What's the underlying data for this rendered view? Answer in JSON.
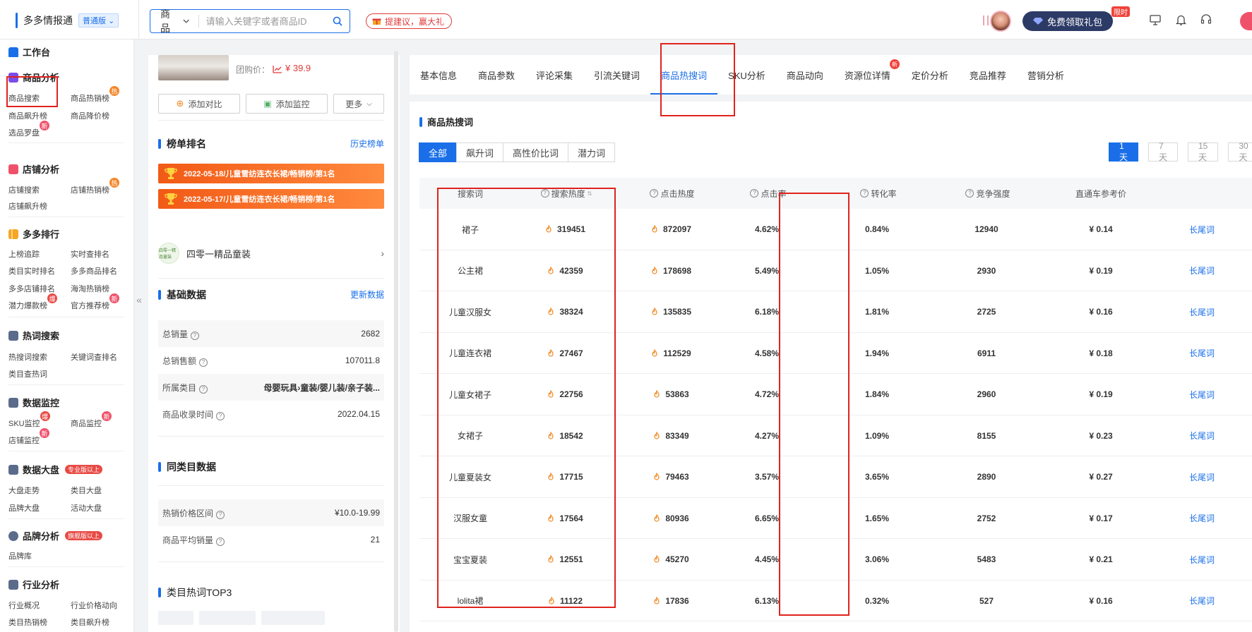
{
  "brand": {
    "name": "多多情报通",
    "plan": "普通版"
  },
  "search": {
    "type": "商品",
    "placeholder": "请输入关键字或者商品ID"
  },
  "suggest_label": "提建议，赢大礼",
  "gift": {
    "label": "免费领取礼包",
    "tag": "限时"
  },
  "sidebar": {
    "sections": [
      {
        "title": "工作台",
        "items": []
      },
      {
        "title": "商品分析",
        "items": [
          {
            "label": "商品搜索"
          },
          {
            "label": "商品热销榜",
            "badge": "热"
          },
          {
            "label": "商品飙升榜"
          },
          {
            "label": "商品降价榜"
          },
          {
            "label": "选品罗盘",
            "badge": "新"
          }
        ]
      },
      {
        "title": "店铺分析",
        "items": [
          {
            "label": "店铺搜索"
          },
          {
            "label": "店铺热销榜",
            "badge": "热"
          },
          {
            "label": "店铺飙升榜"
          }
        ]
      },
      {
        "title": "多多排行",
        "items": [
          {
            "label": "上榜追踪"
          },
          {
            "label": "实时查排名"
          },
          {
            "label": "类目实时排名"
          },
          {
            "label": "多多商品排名"
          },
          {
            "label": "多多店铺排名"
          },
          {
            "label": "海淘热销榜"
          },
          {
            "label": "潜力爆款榜",
            "badge": "爆"
          },
          {
            "label": "官方推荐榜",
            "badge": "新"
          }
        ]
      },
      {
        "title": "热词搜索",
        "items": [
          {
            "label": "热搜词搜索"
          },
          {
            "label": "关键词查排名"
          },
          {
            "label": "类目查热词"
          }
        ]
      },
      {
        "title": "数据监控",
        "items": [
          {
            "label": "SKU监控",
            "badge": "爆"
          },
          {
            "label": "商品监控",
            "badge": "新"
          },
          {
            "label": "店铺监控",
            "badge": "新"
          }
        ]
      },
      {
        "title": "数据大盘",
        "tier": "专业版以上",
        "items": [
          {
            "label": "大盘走势"
          },
          {
            "label": "类目大盘"
          },
          {
            "label": "品牌大盘"
          },
          {
            "label": "活动大盘"
          }
        ]
      },
      {
        "title": "品牌分析",
        "tier": "旗舰版以上",
        "items": [
          {
            "label": "品牌库"
          }
        ]
      },
      {
        "title": "行业分析",
        "items": [
          {
            "label": "行业概况"
          },
          {
            "label": "行业价格动向"
          },
          {
            "label": "类目热销榜"
          },
          {
            "label": "类目飙升榜"
          }
        ]
      }
    ]
  },
  "product": {
    "price_label": "团购价：",
    "price": "¥ 39.9",
    "buttons": {
      "compare": "添加对比",
      "monitor": "添加监控",
      "more": "更多"
    }
  },
  "ranking": {
    "title": "榜单排名",
    "link": "历史榜单",
    "banners": [
      "2022-05-18/儿童雪纺连衣长裙/畅销榜/第1名",
      "2022-05-17/儿童雪纺连衣长裙/畅销榜/第1名"
    ],
    "shop_logo": "四零一精品童装",
    "shop": "四零一精品童装"
  },
  "basic": {
    "title": "基础数据",
    "link": "更新数据",
    "rows": [
      {
        "label": "总销量",
        "value": "2682"
      },
      {
        "label": "总销售额",
        "value": "107011.8"
      },
      {
        "label": "所属类目",
        "value": "母婴玩具›童装/婴儿装/亲子装..."
      },
      {
        "label": "商品收录时间",
        "value": "2022.04.15"
      }
    ]
  },
  "same_category": {
    "title": "同类目数据",
    "rows": [
      {
        "label": "热销价格区间",
        "value": "¥10.0-19.99"
      },
      {
        "label": "商品平均销量",
        "value": "21"
      }
    ]
  },
  "top3": {
    "title": "类目热词TOP3"
  },
  "tabs": [
    {
      "label": "基本信息"
    },
    {
      "label": "商品参数"
    },
    {
      "label": "评论采集"
    },
    {
      "label": "引流关键词"
    },
    {
      "label": "商品热搜词",
      "active": true
    },
    {
      "label": "SKU分析"
    },
    {
      "label": "商品动向"
    },
    {
      "label": "资源位详情",
      "badge": "新"
    },
    {
      "label": "定价分析"
    },
    {
      "label": "竞品推荐"
    },
    {
      "label": "营销分析"
    }
  ],
  "hot": {
    "title": "商品热搜词",
    "filters": [
      "全部",
      "飙升词",
      "高性价比词",
      "潜力词"
    ],
    "ranges": [
      "1天",
      "7天",
      "15天",
      "30天"
    ],
    "headers": [
      "搜索词",
      "搜索热度",
      "点击热度",
      "点击率",
      "转化率",
      "竞争强度",
      "直通车参考价"
    ],
    "link_label": "长尾词",
    "rows": [
      {
        "word": "裙子",
        "search": "319451",
        "click": "872097",
        "ctr": "4.62%",
        "cvr": "0.84%",
        "comp": "12940",
        "price": "¥ 0.14"
      },
      {
        "word": "公主裙",
        "search": "42359",
        "click": "178698",
        "ctr": "5.49%",
        "cvr": "1.05%",
        "comp": "2930",
        "price": "¥ 0.19"
      },
      {
        "word": "儿童汉服女",
        "search": "38324",
        "click": "135835",
        "ctr": "6.18%",
        "cvr": "1.81%",
        "comp": "2725",
        "price": "¥ 0.16"
      },
      {
        "word": "儿童连衣裙",
        "search": "27467",
        "click": "112529",
        "ctr": "4.58%",
        "cvr": "1.94%",
        "comp": "6911",
        "price": "¥ 0.18"
      },
      {
        "word": "儿童女裙子",
        "search": "22756",
        "click": "53863",
        "ctr": "4.72%",
        "cvr": "1.84%",
        "comp": "2960",
        "price": "¥ 0.19"
      },
      {
        "word": "女裙子",
        "search": "18542",
        "click": "83349",
        "ctr": "4.27%",
        "cvr": "1.09%",
        "comp": "8155",
        "price": "¥ 0.23"
      },
      {
        "word": "儿童夏装女",
        "search": "17715",
        "click": "79463",
        "ctr": "3.57%",
        "cvr": "3.65%",
        "comp": "2890",
        "price": "¥ 0.27"
      },
      {
        "word": "汉服女童",
        "search": "17564",
        "click": "80936",
        "ctr": "6.65%",
        "cvr": "1.65%",
        "comp": "2752",
        "price": "¥ 0.17"
      },
      {
        "word": "宝宝夏装",
        "search": "12551",
        "click": "45270",
        "ctr": "4.45%",
        "cvr": "3.06%",
        "comp": "5483",
        "price": "¥ 0.21"
      },
      {
        "word": "lolita裙",
        "search": "11122",
        "click": "17836",
        "ctr": "6.13%",
        "cvr": "0.32%",
        "comp": "527",
        "price": "¥ 0.16"
      }
    ]
  },
  "colors": {
    "accent": "#1a6fe8",
    "highlight": "#e0231d",
    "flame": "#f08a24",
    "banner": "#f25a16"
  },
  "icons": [
    "search-icon",
    "chevron-down-icon",
    "gift-icon",
    "monitor-icon",
    "bell-icon",
    "headset-icon",
    "trophy-icon",
    "flame-icon",
    "help-icon",
    "chevron-right-icon",
    "collapse-icon"
  ]
}
